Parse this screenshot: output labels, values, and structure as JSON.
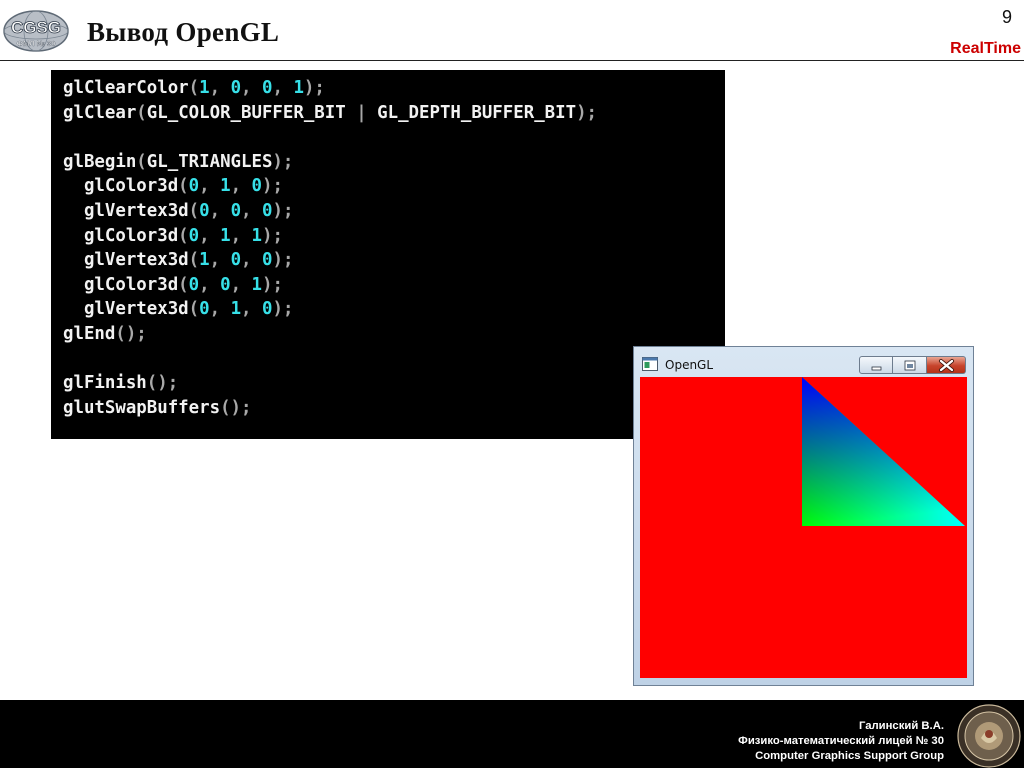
{
  "slide": {
    "title": "Вывод OpenGL",
    "page_number": "9",
    "brand": "RealTime",
    "logo": {
      "main_text": "CGSG",
      "sub_text": "ФМЛ № 30",
      "icon": "cgsg-logo-icon"
    }
  },
  "code": {
    "lines": [
      [
        [
          "fn",
          "glClearColor"
        ],
        [
          "punc",
          "("
        ],
        [
          "num",
          "1"
        ],
        [
          "punc",
          ", "
        ],
        [
          "num",
          "0"
        ],
        [
          "punc",
          ", "
        ],
        [
          "num",
          "0"
        ],
        [
          "punc",
          ", "
        ],
        [
          "num",
          "1"
        ],
        [
          "punc",
          ");"
        ]
      ],
      [
        [
          "fn",
          "glClear"
        ],
        [
          "punc",
          "("
        ],
        [
          "fn",
          "GL_COLOR_BUFFER_BIT"
        ],
        [
          "punc",
          " | "
        ],
        [
          "fn",
          "GL_DEPTH_BUFFER_BIT"
        ],
        [
          "punc",
          ");"
        ]
      ],
      [],
      [
        [
          "fn",
          "glBegin"
        ],
        [
          "punc",
          "("
        ],
        [
          "fn",
          "GL_TRIANGLES"
        ],
        [
          "punc",
          ");"
        ]
      ],
      [
        [
          "fn",
          "  glColor3d"
        ],
        [
          "punc",
          "("
        ],
        [
          "num",
          "0"
        ],
        [
          "punc",
          ", "
        ],
        [
          "num",
          "1"
        ],
        [
          "punc",
          ", "
        ],
        [
          "num",
          "0"
        ],
        [
          "punc",
          ");"
        ]
      ],
      [
        [
          "fn",
          "  glVertex3d"
        ],
        [
          "punc",
          "("
        ],
        [
          "num",
          "0"
        ],
        [
          "punc",
          ", "
        ],
        [
          "num",
          "0"
        ],
        [
          "punc",
          ", "
        ],
        [
          "num",
          "0"
        ],
        [
          "punc",
          ");"
        ]
      ],
      [
        [
          "fn",
          "  glColor3d"
        ],
        [
          "punc",
          "("
        ],
        [
          "num",
          "0"
        ],
        [
          "punc",
          ", "
        ],
        [
          "num",
          "1"
        ],
        [
          "punc",
          ", "
        ],
        [
          "num",
          "1"
        ],
        [
          "punc",
          ");"
        ]
      ],
      [
        [
          "fn",
          "  glVertex3d"
        ],
        [
          "punc",
          "("
        ],
        [
          "num",
          "1"
        ],
        [
          "punc",
          ", "
        ],
        [
          "num",
          "0"
        ],
        [
          "punc",
          ", "
        ],
        [
          "num",
          "0"
        ],
        [
          "punc",
          ");"
        ]
      ],
      [
        [
          "fn",
          "  glColor3d"
        ],
        [
          "punc",
          "("
        ],
        [
          "num",
          "0"
        ],
        [
          "punc",
          ", "
        ],
        [
          "num",
          "0"
        ],
        [
          "punc",
          ", "
        ],
        [
          "num",
          "1"
        ],
        [
          "punc",
          ");"
        ]
      ],
      [
        [
          "fn",
          "  glVertex3d"
        ],
        [
          "punc",
          "("
        ],
        [
          "num",
          "0"
        ],
        [
          "punc",
          ", "
        ],
        [
          "num",
          "1"
        ],
        [
          "punc",
          ", "
        ],
        [
          "num",
          "0"
        ],
        [
          "punc",
          ");"
        ]
      ],
      [
        [
          "fn",
          "glEnd"
        ],
        [
          "punc",
          "();"
        ]
      ],
      [],
      [
        [
          "fn",
          "glFinish"
        ],
        [
          "punc",
          "();"
        ]
      ],
      [
        [
          "fn",
          "glutSwapBuffers"
        ],
        [
          "punc",
          "();"
        ]
      ]
    ]
  },
  "window": {
    "title": "OpenGL",
    "icons": {
      "app": "window-app-icon",
      "minimize": "minimize-icon",
      "maximize": "maximize-icon",
      "close": "close-icon"
    },
    "clear_color": "#ff0000",
    "vertex_colors": [
      "#00ff00",
      "#00ffff",
      "#0000ff"
    ]
  },
  "footer": {
    "lines": [
      "Галинский В.А.",
      "Физико-математический лицей № 30",
      "Computer Graphics Support Group"
    ],
    "seal_icon": "school-seal-icon"
  }
}
